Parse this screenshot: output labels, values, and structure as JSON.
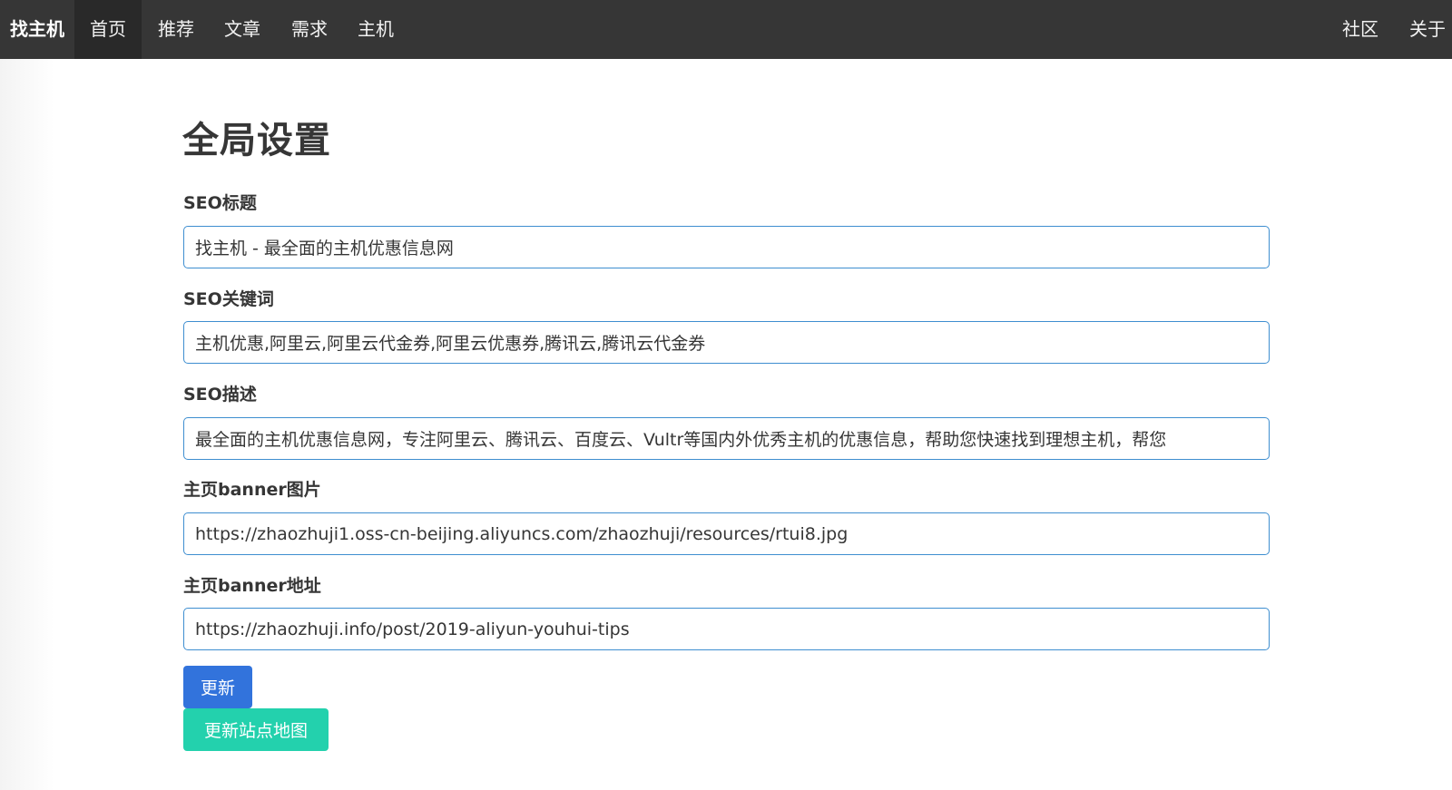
{
  "navbar": {
    "brand": "找主机",
    "items": [
      "首页",
      "推荐",
      "文章",
      "需求",
      "主机"
    ],
    "right_items": [
      "社区",
      "关于"
    ]
  },
  "main": {
    "title": "全局设置",
    "fields": [
      {
        "label": "SEO标题",
        "value": "找主机 - 最全面的主机优惠信息网"
      },
      {
        "label": "SEO关键词",
        "value": "主机优惠,阿里云,阿里云代金券,阿里云优惠券,腾讯云,腾讯云代金券"
      },
      {
        "label": "SEO描述",
        "value": "最全面的主机优惠信息网，专注阿里云、腾讯云、百度云、Vultr等国内外优秀主机的优惠信息，帮助您快速找到理想主机，帮您"
      },
      {
        "label": "主页banner图片",
        "value": "https://zhaozhuji1.oss-cn-beijing.aliyuncs.com/zhaozhuji/resources/rtui8.jpg"
      },
      {
        "label": "主页banner地址",
        "value": "https://zhaozhuji.info/post/2019-aliyun-youhui-tips"
      }
    ],
    "buttons": {
      "update": "更新",
      "update_sitemap": "更新站点地图"
    }
  },
  "colors": {
    "navbar_bg": "#363636",
    "input_border": "#3e8ed0",
    "update_button": "#3273dc",
    "sitemap_button": "#23d1ad"
  }
}
